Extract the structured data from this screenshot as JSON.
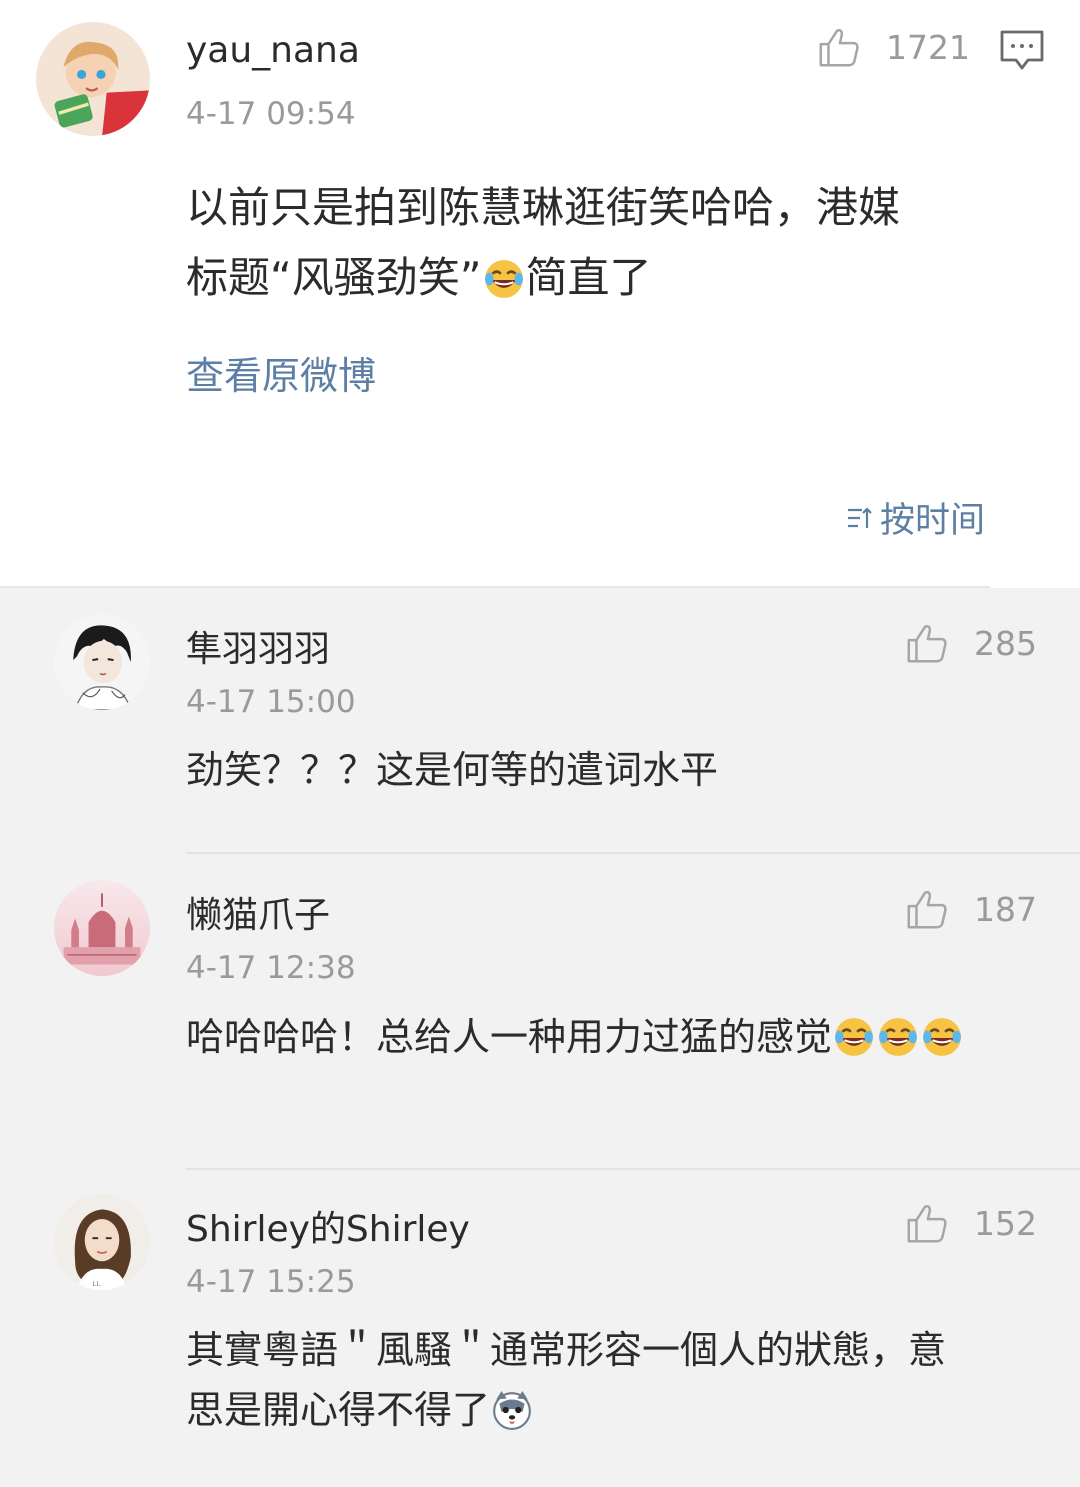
{
  "main_post": {
    "username": "yau_nana",
    "timestamp": "4-17 09:54",
    "likes": "1721",
    "text_line1": "以前只是拍到陈慧琳逛街笑哈哈，港媒",
    "text_line2_pre": "标题“风骚劲笑”",
    "text_line2_post": "简直了",
    "view_original_label": "查看原微博",
    "sort_label": "按时间",
    "icons": {
      "like": "thumbs-up-icon",
      "comment": "comment-icon",
      "sort": "sort-icon",
      "emoji": "laughing-tears-emoji"
    }
  },
  "comments": [
    {
      "username": "隼羽羽羽",
      "timestamp": "4-17 15:00",
      "likes": "285",
      "text": "劲笑？？？这是何等的遣词水平"
    },
    {
      "username": "懒猫爪子",
      "timestamp": "4-17 12:38",
      "likes": "187",
      "text": "哈哈哈哈！总给人一种用力过猛的感觉"
    },
    {
      "username": "Shirley的Shirley",
      "timestamp": "4-17 15:25",
      "likes": "152",
      "text_line1": "其實粵語＂風騷＂通常形容一個人的狀態，意",
      "text_line2": "思是開心得不得了"
    }
  ],
  "colors": {
    "link": "#5d7fa6",
    "meta": "#9a9a9a",
    "text": "#2b2b2b",
    "background": "#f2f2f2",
    "card": "#ffffff"
  }
}
